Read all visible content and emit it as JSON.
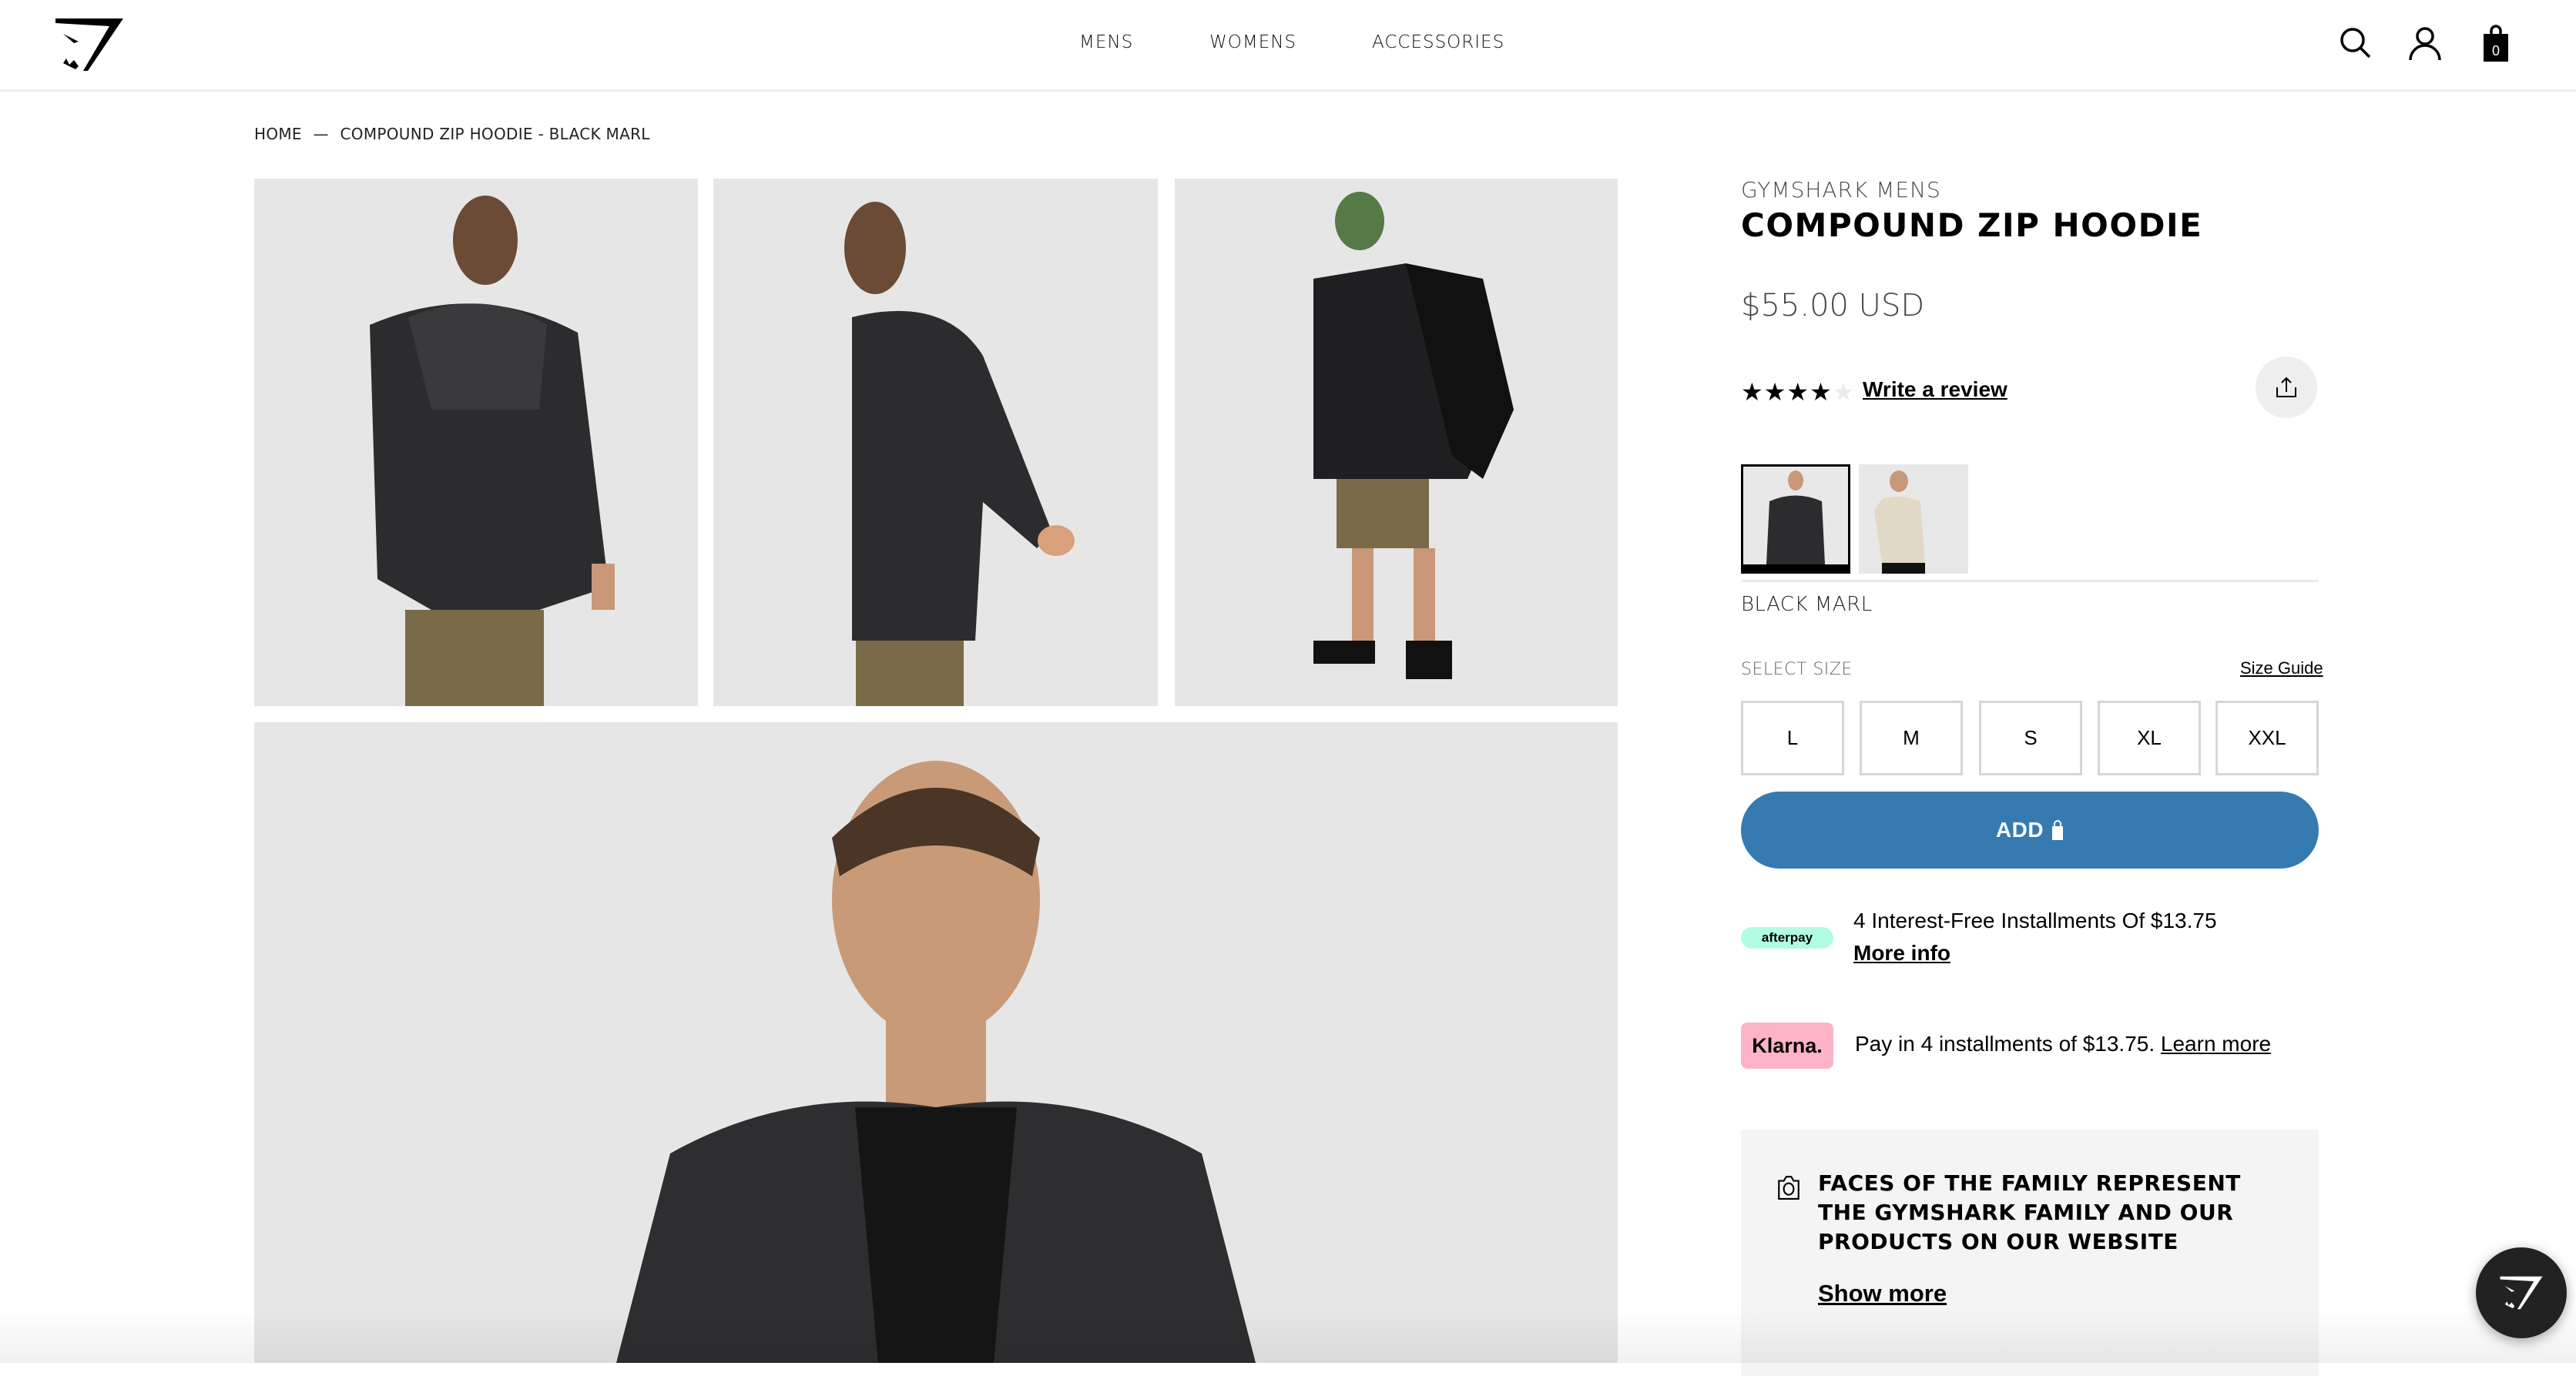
{
  "header": {
    "logo": "gymshark-logo",
    "nav": [
      {
        "label": "MENS"
      },
      {
        "label": "WOMENS"
      },
      {
        "label": "ACCESSORIES"
      }
    ],
    "icons": [
      "search-icon",
      "account-icon",
      "bag-icon"
    ],
    "cart_count": "0"
  },
  "breadcrumb": {
    "items": [
      "HOME",
      "COMPOUND ZIP HOODIE - BLACK MARL"
    ],
    "separator": "—"
  },
  "gallery": {
    "images": [
      {
        "alt": "Model wearing hoodie, back view"
      },
      {
        "alt": "Model wearing hoodie, side view"
      },
      {
        "alt": "Model wearing hoodie with backpack and headphones, full length"
      },
      {
        "alt": "Model wearing hoodie, front close-up"
      }
    ]
  },
  "product": {
    "brand": "GYMSHARK MENS",
    "title": "COMPOUND ZIP HOODIE",
    "price": "$55.00 USD",
    "rating": 4,
    "rating_max": 5,
    "write_review": "Write a review",
    "share_icon": "share-icon",
    "swatches": [
      {
        "name": "Black Marl",
        "selected": true
      },
      {
        "name": "Light Beige",
        "selected": false
      }
    ],
    "color_name": "BLACK MARL",
    "select_size_label": "SELECT SIZE",
    "size_guide": "Size Guide",
    "sizes": [
      "L",
      "M",
      "S",
      "XL",
      "XXL"
    ],
    "add_button": "ADD",
    "accent_color": "#357bb2"
  },
  "payments": {
    "afterpay": {
      "badge": "afterpay",
      "text": "4 Interest-Free Installments Of $13.75",
      "link": "More info",
      "color": "#b2fce4"
    },
    "klarna": {
      "badge": "Klarna.",
      "text": "Pay in 4 installments of $13.75.",
      "link": "Learn more",
      "color": "#ffb3c7"
    }
  },
  "faces": {
    "icon": "camera-icon",
    "text": "FACES OF THE FAMILY REPRESENT THE GYMSHARK FAMILY AND OUR PRODUCTS ON OUR WEBSITE",
    "link": "Show more"
  },
  "chat": {
    "icon": "gymshark-chat-icon"
  }
}
